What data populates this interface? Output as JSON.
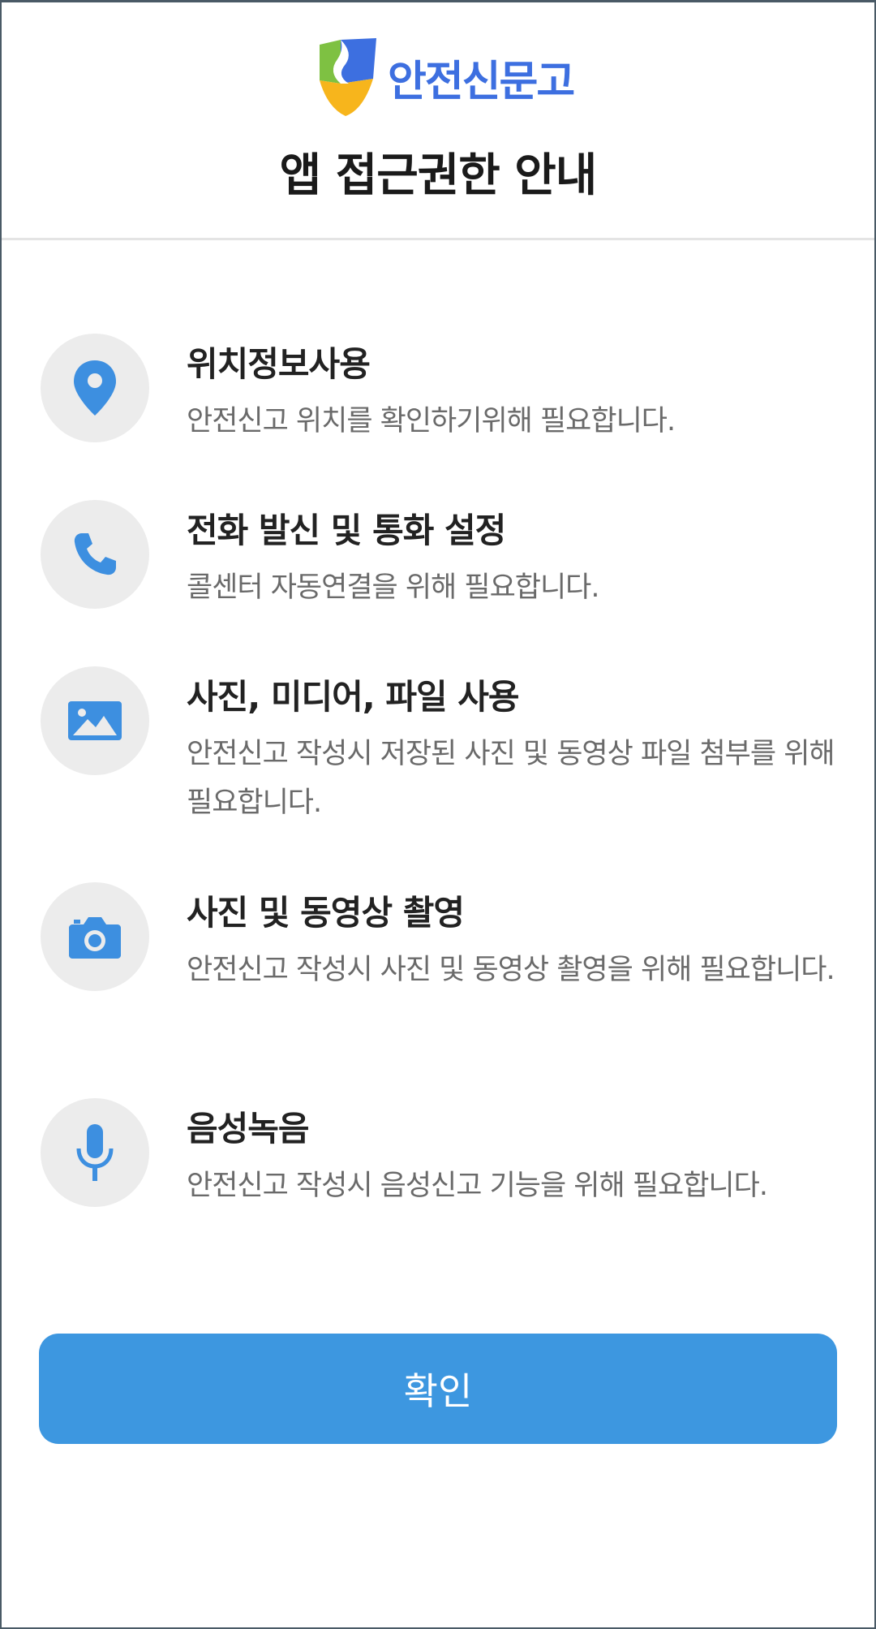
{
  "logo": {
    "text": "안전신문고",
    "icon": "shield-logo-icon",
    "text_color": "#3d6fe0"
  },
  "title": "앱 접근권한 안내",
  "permissions": [
    {
      "icon": "location-pin-icon",
      "title": "위치정보사용",
      "description": "안전신고 위치를 확인하기위해 필요합니다."
    },
    {
      "icon": "phone-icon",
      "title": "전화 발신 및 통화 설정",
      "description": "콜센터 자동연결을 위해 필요합니다."
    },
    {
      "icon": "image-icon",
      "title": "사진, 미디어, 파일 사용",
      "description": "안전신고 작성시 저장된 사진 및 동영상 파일 첨부를 위해 필요합니다."
    },
    {
      "icon": "camera-icon",
      "title": "사진 및 동영상 촬영",
      "description": "안전신고 작성시 사진 및 동영상 촬영을 위해 필요합니다."
    },
    {
      "icon": "microphone-icon",
      "title": "음성녹음",
      "description": "안전신고 작성시 음성신고 기능을 위해 필요합니다."
    }
  ],
  "confirm_button": {
    "label": "확인"
  },
  "colors": {
    "accent": "#3d97e0",
    "icon_blue": "#3d8fe0",
    "icon_background": "#ececec"
  }
}
